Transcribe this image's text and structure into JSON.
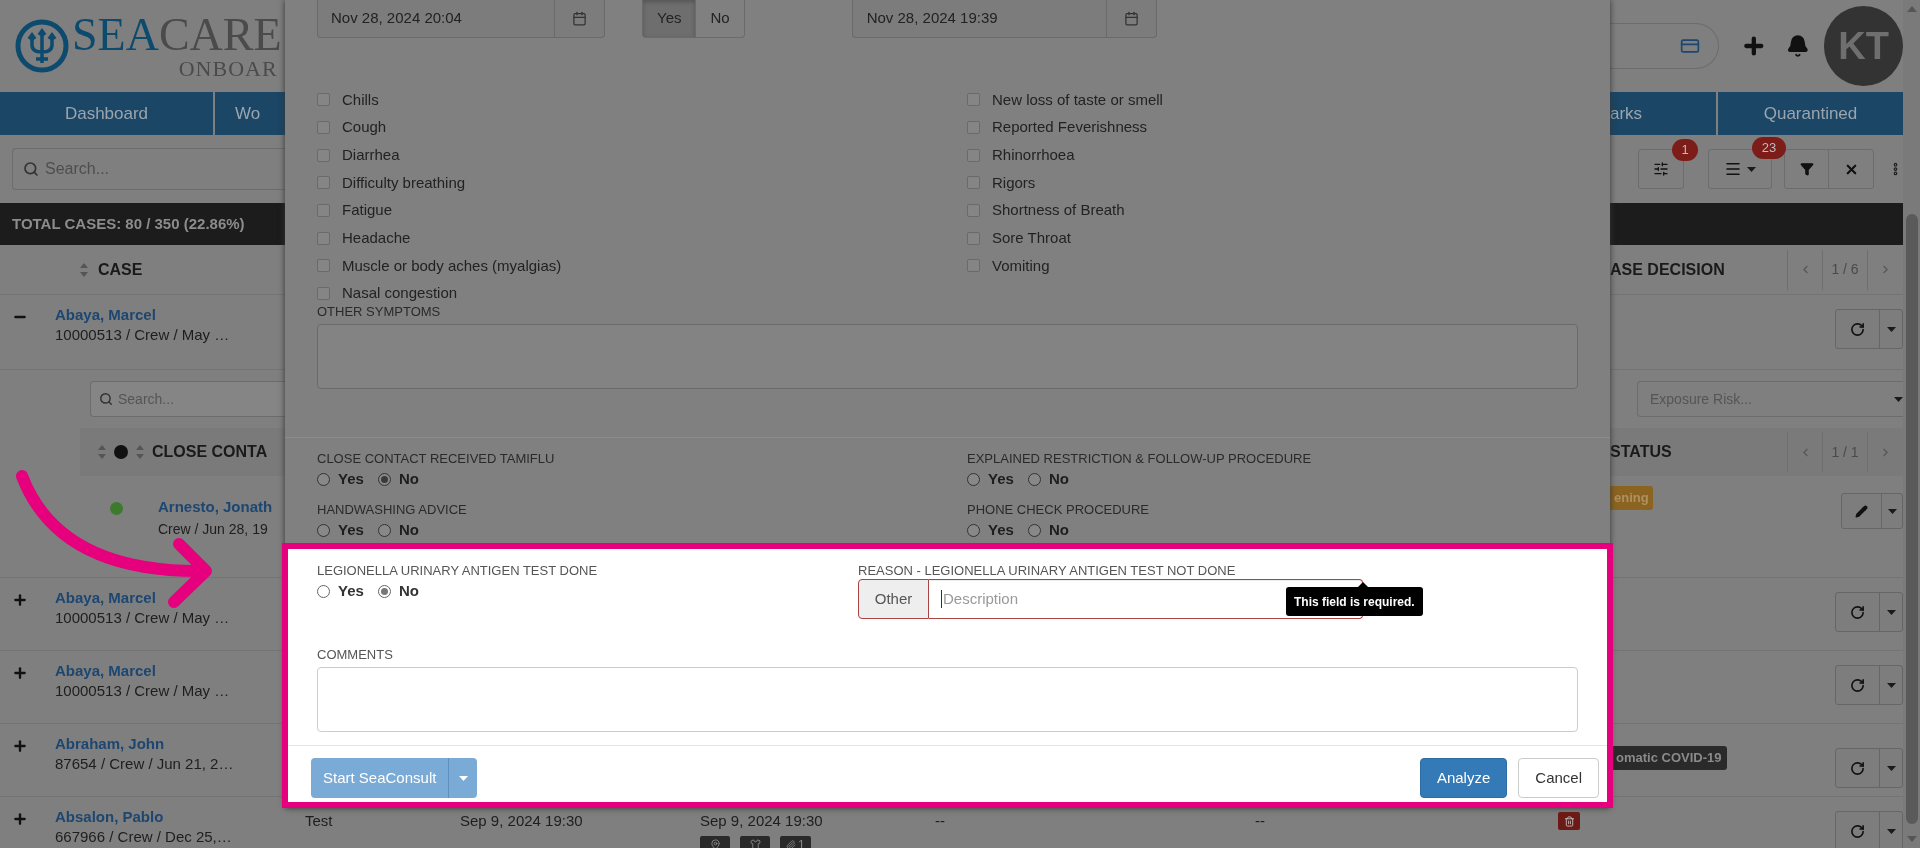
{
  "header": {
    "logo_primary": "SEA",
    "logo_secondary": "CARE",
    "logo_sub": "ONBOAR",
    "avatar": "KT"
  },
  "nav": {
    "tabs": [
      {
        "label": "Dashboard"
      },
      {
        "label": "Wo"
      },
      {
        "label": "arks"
      },
      {
        "label": "Quarantined"
      }
    ]
  },
  "toolbar": {
    "search_placeholder": "Search...",
    "settings_badge": "1",
    "columns_badge": "23"
  },
  "summary": "TOTAL CASES: 80 / 350 (22.86%)",
  "table": {
    "column": "CASE",
    "right_column": "ASE DECISION",
    "pager": "1 / 6",
    "rows": [
      {
        "expanded": true,
        "name": "Abaya, Marcel",
        "detail": "10000513 / Crew / May …"
      },
      {
        "expanded": false,
        "name": "Abaya, Marcel",
        "detail": "10000513 / Crew / May …"
      },
      {
        "expanded": false,
        "name": "Abaya, Marcel",
        "detail": "10000513 / Crew / May …"
      },
      {
        "expanded": false,
        "name": "Abraham, John",
        "detail": "87654 / Crew / Jun 21, 2…",
        "tag": "omatic COVID-19"
      },
      {
        "expanded": false,
        "name": "Absalon, Pablo",
        "detail": "667966 / Crew / Dec 25,…",
        "cells": [
          "Test",
          "Sep 9, 2024 19:30",
          "Sep 9, 2024 19:30",
          "--",
          "--"
        ],
        "attachment_count": "1"
      }
    ]
  },
  "contacts": {
    "search_placeholder": "Search...",
    "filter_placeholder": "Exposure Risk...",
    "column": "CLOSE CONTA",
    "right_column": "STATUS",
    "pager": "1 / 1",
    "rows": [
      {
        "name": "Arnesto, Jonath",
        "detail": "Crew / Jun 28, 19",
        "color": "#3d7a2e",
        "tag": "ening"
      }
    ]
  },
  "modal": {
    "dates": [
      {
        "value": "Nov 28, 2024 20:04"
      },
      {
        "value": "Nov 28, 2024 19:39"
      }
    ],
    "toggle": [
      {
        "label": "Yes",
        "selected": true
      },
      {
        "label": "No",
        "selected": false
      }
    ],
    "symptoms_left": [
      {
        "label": "Chills",
        "checked": false
      },
      {
        "label": "Cough",
        "checked": false
      },
      {
        "label": "Diarrhea",
        "checked": false
      },
      {
        "label": "Difficulty breathing",
        "checked": false
      },
      {
        "label": "Fatigue",
        "checked": false
      },
      {
        "label": "Headache",
        "checked": false
      },
      {
        "label": "Muscle or body aches (myalgias)",
        "checked": false
      },
      {
        "label": "Nasal congestion",
        "checked": false
      }
    ],
    "symptoms_right": [
      {
        "label": "New loss of taste or smell",
        "checked": false
      },
      {
        "label": "Reported Feverishness",
        "checked": false
      },
      {
        "label": "Rhinorrhoea",
        "checked": false
      },
      {
        "label": "Rigors",
        "checked": false
      },
      {
        "label": "Shortness of Breath",
        "checked": false
      },
      {
        "label": "Sore Throat",
        "checked": false
      },
      {
        "label": "Vomiting",
        "checked": false
      }
    ],
    "other_symptoms_label": "OTHER SYMPTOMS",
    "questions": [
      {
        "label": "CLOSE CONTACT RECEIVED TAMIFLU",
        "options": [
          {
            "label": "Yes",
            "selected": false
          },
          {
            "label": "No",
            "selected": true
          }
        ]
      },
      {
        "label": "EXPLAINED RESTRICTION & FOLLOW-UP PROCEDURE",
        "options": [
          {
            "label": "Yes",
            "selected": false
          },
          {
            "label": "No",
            "selected": false
          }
        ]
      },
      {
        "label": "HANDWASHING ADVICE",
        "options": [
          {
            "label": "Yes",
            "selected": false
          },
          {
            "label": "No",
            "selected": false
          }
        ]
      },
      {
        "label": "PHONE CHECK PROCEDURE",
        "options": [
          {
            "label": "Yes",
            "selected": false
          },
          {
            "label": "No",
            "selected": false
          }
        ]
      }
    ],
    "test": {
      "label": "LEGIONELLA URINARY ANTIGEN TEST DONE",
      "options": [
        {
          "label": "Yes",
          "selected": false
        },
        {
          "label": "No",
          "selected": true
        }
      ]
    },
    "reason": {
      "label": "REASON - LEGIONELLA URINARY ANTIGEN TEST NOT DONE",
      "addon": "Other",
      "placeholder": "Description",
      "tooltip": "This field is required."
    },
    "comments_label": "COMMENTS",
    "footer": {
      "consult": "Start SeaConsult",
      "analyze": "Analyze",
      "cancel": "Cancel"
    }
  }
}
